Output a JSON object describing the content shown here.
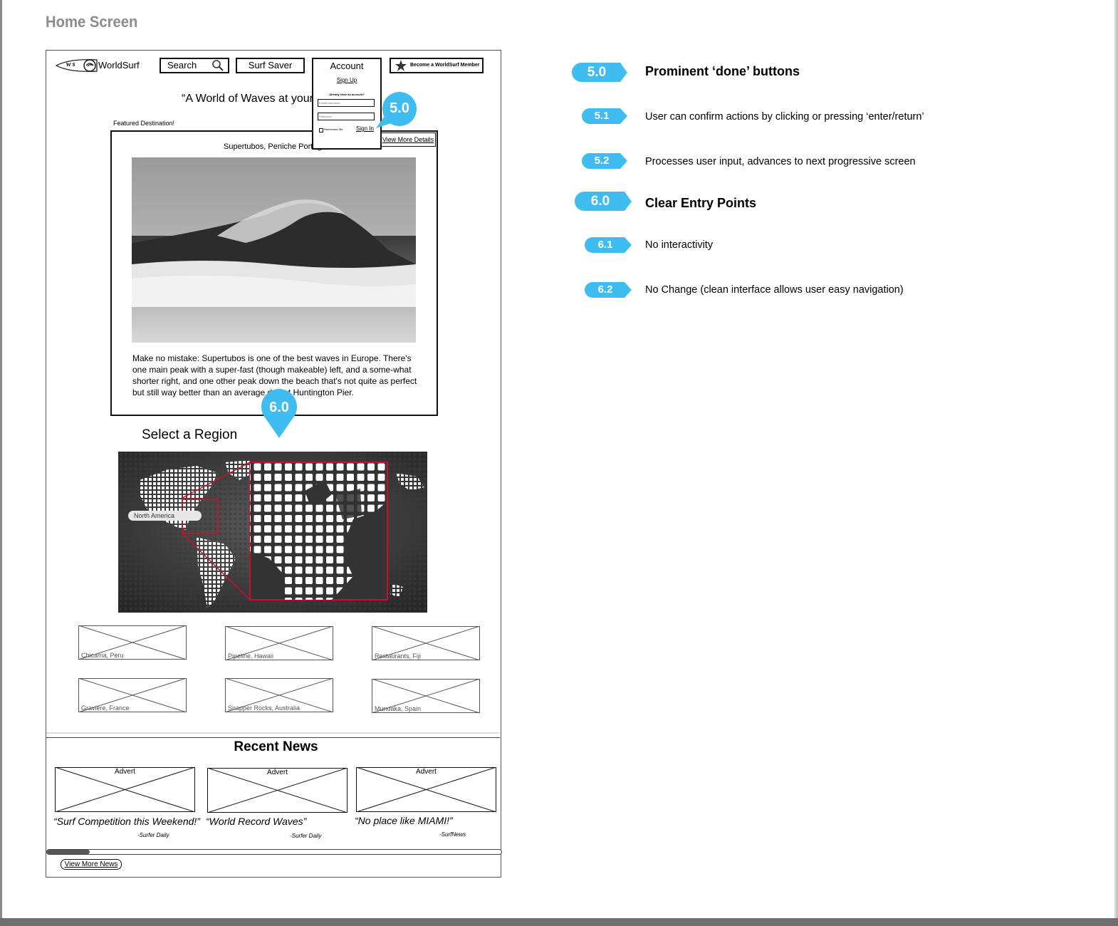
{
  "page": {
    "title": "Home Screen"
  },
  "nav": {
    "logo_text": "WorldSurf",
    "logo_mark": "ws",
    "search_label": "Search",
    "surf_saver_label": "Surf Saver",
    "member_label": "Become a WorldSurf Member"
  },
  "account": {
    "title": "Account",
    "sign_up": "Sign Up",
    "have_account": "Already have an account?",
    "email_placeholder": "Email/Username",
    "password_placeholder": "Password",
    "remember": "Remember Me",
    "sign_in": "Sign In"
  },
  "hero": {
    "tagline": "“A World of Waves at your",
    "featured_label": "Featured Destination!",
    "destination_title": "Supertubos, Peniche Portugal",
    "view_more_details": "View More Details",
    "description": "Make no mistake: Supertubos is one of the best waves in Europe. There's one main peak with a super-fast (though makeable) left, and a some-what shorter right, and one other peak down the beach that's not quite as perfect but still way better than an average day at Huntington Pier."
  },
  "region": {
    "title": "Select a Region",
    "map_label": "North America"
  },
  "destinations": [
    {
      "label": "Chicama, Peru"
    },
    {
      "label": "Pipeline, Hawaii"
    },
    {
      "label": "Restaurants, Fiji"
    },
    {
      "label": "Graviere, France"
    },
    {
      "label": "Snapper Rocks, Australia"
    },
    {
      "label": "Mundaka, Spain"
    }
  ],
  "news": {
    "title": "Recent News",
    "items": [
      {
        "advert": "Advert",
        "quote": "“Surf Competition this Weekend!”",
        "source": "-Surfer Daily"
      },
      {
        "advert": "Advert",
        "quote": "“World Record Waves”",
        "source": "-Surfer Daily"
      },
      {
        "advert": "Advert",
        "quote": "“No place like MIAMI!”",
        "source": "-SurfNews"
      }
    ],
    "view_more": "View More News"
  },
  "callouts": [
    {
      "label": "5.0"
    },
    {
      "label": "6.0"
    }
  ],
  "legend": [
    {
      "badge": "5.0",
      "text": "Prominent ‘done’ buttons",
      "major": true
    },
    {
      "badge": "5.1",
      "text": "User can confirm actions by clicking or pressing ‘enter/return’",
      "major": false
    },
    {
      "badge": "5.2",
      "text": "Processes user input, advances to next progressive screen",
      "major": false
    },
    {
      "badge": "6.0",
      "text": "Clear Entry Points",
      "major": true
    },
    {
      "badge": "6.1",
      "text": "No interactivity",
      "major": false
    },
    {
      "badge": "6.2",
      "text": "No Change (clean interface allows user easy navigation)",
      "major": false
    }
  ],
  "colors": {
    "accent": "#3fbdf0",
    "highlight_box": "#c8102e"
  }
}
